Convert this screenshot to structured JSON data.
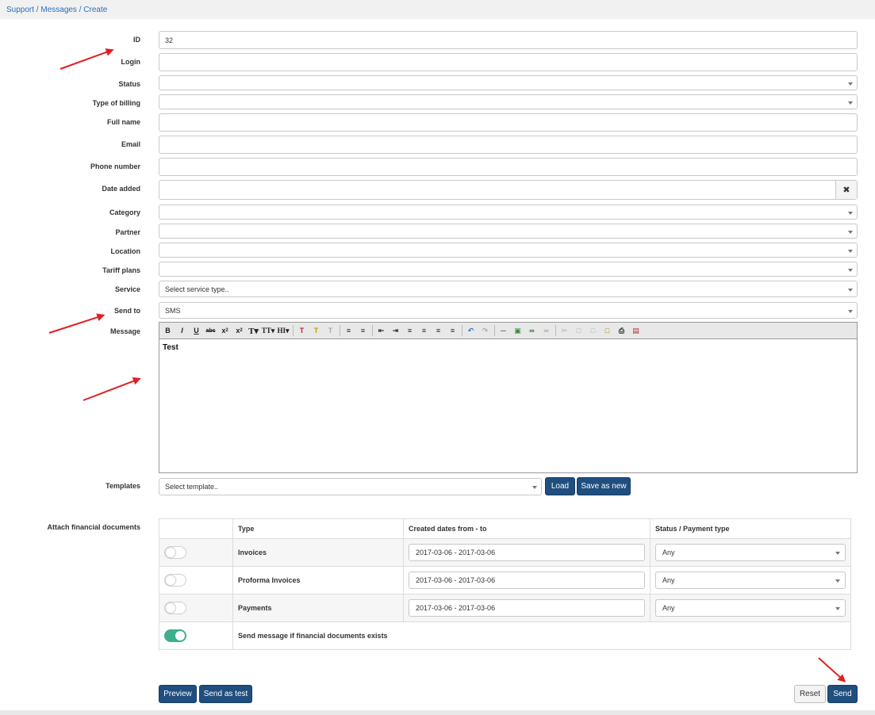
{
  "breadcrumb": "Support / Messages / Create",
  "form": {
    "id_label": "ID",
    "id_value": "32",
    "login_label": "Login",
    "status_label": "Status",
    "billing_label": "Type of billing",
    "fullname_label": "Full name",
    "email_label": "Email",
    "phone_label": "Phone number",
    "date_label": "Date added",
    "category_label": "Category",
    "partner_label": "Partner",
    "location_label": "Location",
    "tariff_label": "Tariff plans",
    "service_label": "Service",
    "service_placeholder": "Select service type..",
    "sendto_label": "Send to",
    "sendto_value": "SMS",
    "message_label": "Message",
    "message_value": "Test",
    "templates_label": "Templates",
    "templates_placeholder": "Select template..",
    "load_button": "Load",
    "save_new_button": "Save as new",
    "attach_label": "Attach financial documents"
  },
  "editor_toolbar": [
    "bold",
    "italic",
    "underline",
    "strikethrough",
    "subscript",
    "superscript",
    "font-size",
    "font-family",
    "heading",
    "text-color",
    "highlight",
    "clear-format",
    "bullet-list",
    "number-list",
    "outdent",
    "indent",
    "align-left",
    "align-center",
    "align-right",
    "justify",
    "undo",
    "redo",
    "horizontal-rule",
    "image",
    "link",
    "unlink",
    "cut",
    "copy",
    "paste",
    "paste-word",
    "print",
    "source"
  ],
  "fin_table": {
    "headers": [
      "",
      "Type",
      "Created dates from - to",
      "Status / Payment type"
    ],
    "rows": [
      {
        "type": "Invoices",
        "dates": "2017-03-06 - 2017-03-06",
        "status": "Any",
        "enabled": false
      },
      {
        "type": "Proforma Invoices",
        "dates": "2017-03-06 - 2017-03-06",
        "status": "Any",
        "enabled": false
      },
      {
        "type": "Payments",
        "dates": "2017-03-06 - 2017-03-06",
        "status": "Any",
        "enabled": false
      }
    ],
    "send_if_exists_label": "Send message if financial documents exists",
    "send_if_exists_enabled": true
  },
  "actions": {
    "preview": "Preview",
    "send_as_test": "Send as test",
    "reset": "Reset",
    "send": "Send"
  },
  "colors": {
    "primary": "#1f4e7f",
    "toggle_on": "#3fae8c",
    "annotation_arrow": "#e02020",
    "link": "#2a6ebb"
  }
}
